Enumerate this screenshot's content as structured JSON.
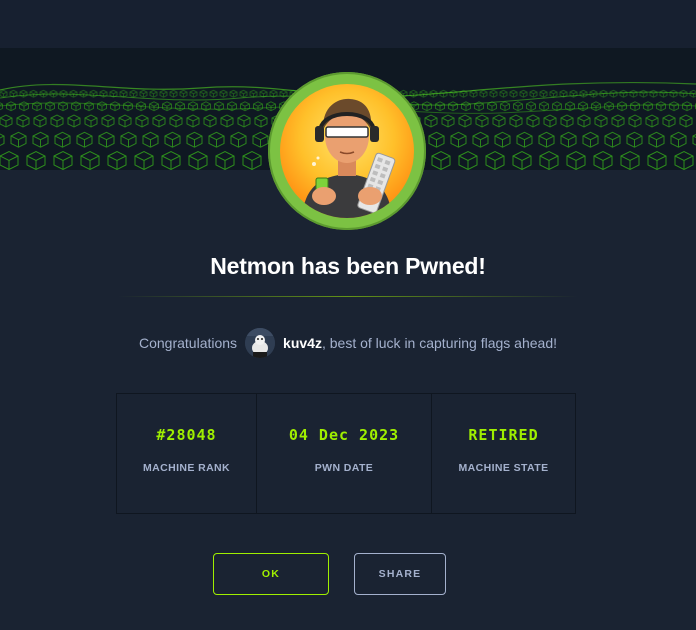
{
  "header": {
    "title": "Netmon has been Pwned!"
  },
  "congrats": {
    "prefix": "Congratulations",
    "username": "kuv4z",
    "suffix": ", best of luck in capturing flags ahead!"
  },
  "stats": [
    {
      "value": "#28048",
      "label": "MACHINE RANK"
    },
    {
      "value": "04 Dec 2023",
      "label": "PWN DATE"
    },
    {
      "value": "RETIRED",
      "label": "MACHINE STATE"
    }
  ],
  "buttons": {
    "ok": "OK",
    "share": "SHARE"
  },
  "colors": {
    "background": "#1a2332",
    "accent": "#9fef00",
    "muted": "#a4b1cd"
  }
}
